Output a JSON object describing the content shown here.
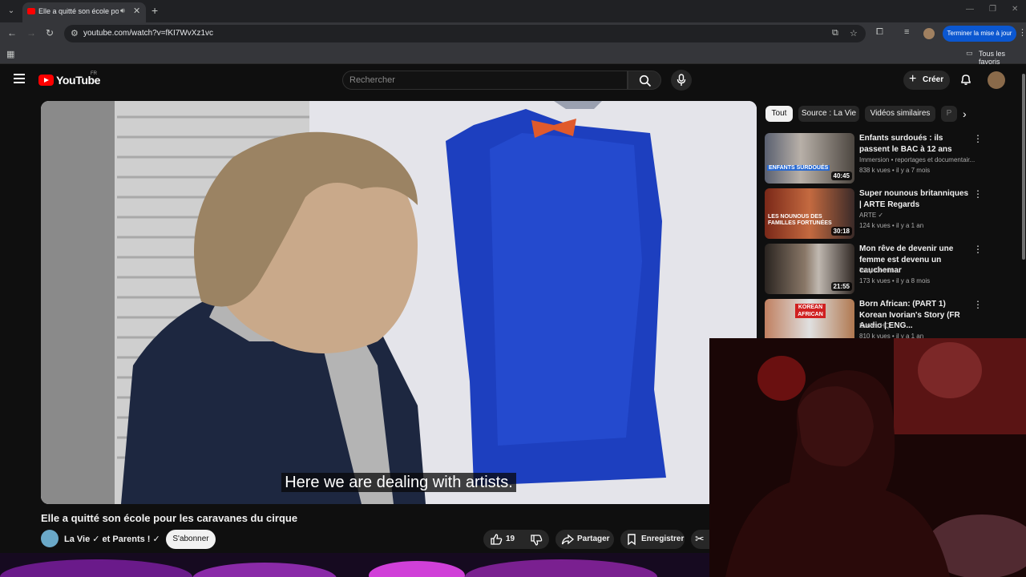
{
  "browser": {
    "tab_title": "Elle a quitté son école pour les caravanes du cirque",
    "url": "youtube.com/watch?v=fKI7WvXz1vc",
    "update_label": "Terminer la mise à jour",
    "bookmarks_label": "Tous les favoris"
  },
  "masthead": {
    "logo_text": "YouTube",
    "region": "FR",
    "search_placeholder": "Rechercher",
    "create_label": "Créer"
  },
  "video": {
    "subtitle": "Here we are dealing with artists.",
    "title": "Elle a quitté son école pour les caravanes du cirque",
    "channel": "La Vie ✓ et Parents ! ✓",
    "subscribe_label": "S'abonner",
    "like_count": "19",
    "share_label": "Partager",
    "save_label": "Enregistrer"
  },
  "chips": [
    "Tout",
    "Source : La Vie",
    "Vidéos similaires",
    "P"
  ],
  "recommendations": [
    {
      "title": "Enfants surdoués : ils passent le BAC à 12 ans",
      "channel": "Immersion • reportages et documentair...",
      "meta": "838 k vues • il y a 7 mois",
      "duration": "40:45",
      "thumb_text": "ENFANTS SURDOUÉS"
    },
    {
      "title": "Super nounous britanniques | ARTE Regards",
      "channel": "ARTE ✓",
      "meta": "124 k vues • il y a 1 an",
      "duration": "30:18",
      "thumb_text": "LES NOUNOUS DES FAMILLES FORTUNÉES"
    },
    {
      "title": "Mon rêve de devenir une femme est devenu un cauchemar",
      "channel": "Tony Comiti",
      "meta": "173 k vues • il y a 8 mois",
      "duration": "21:55",
      "thumb_text": ""
    },
    {
      "title": "Born African: (PART 1) Korean Ivorian's Story (FR Audio | ENG...",
      "channel": "Evolve HQ",
      "meta": "810 k vues • il y a 1 an",
      "duration": "",
      "thumb_text": "KOREAN AFRICAN"
    }
  ],
  "colors": {
    "brand_red": "#ff0000",
    "background": "#0f0f0f",
    "update_blue": "#0b57d0"
  }
}
